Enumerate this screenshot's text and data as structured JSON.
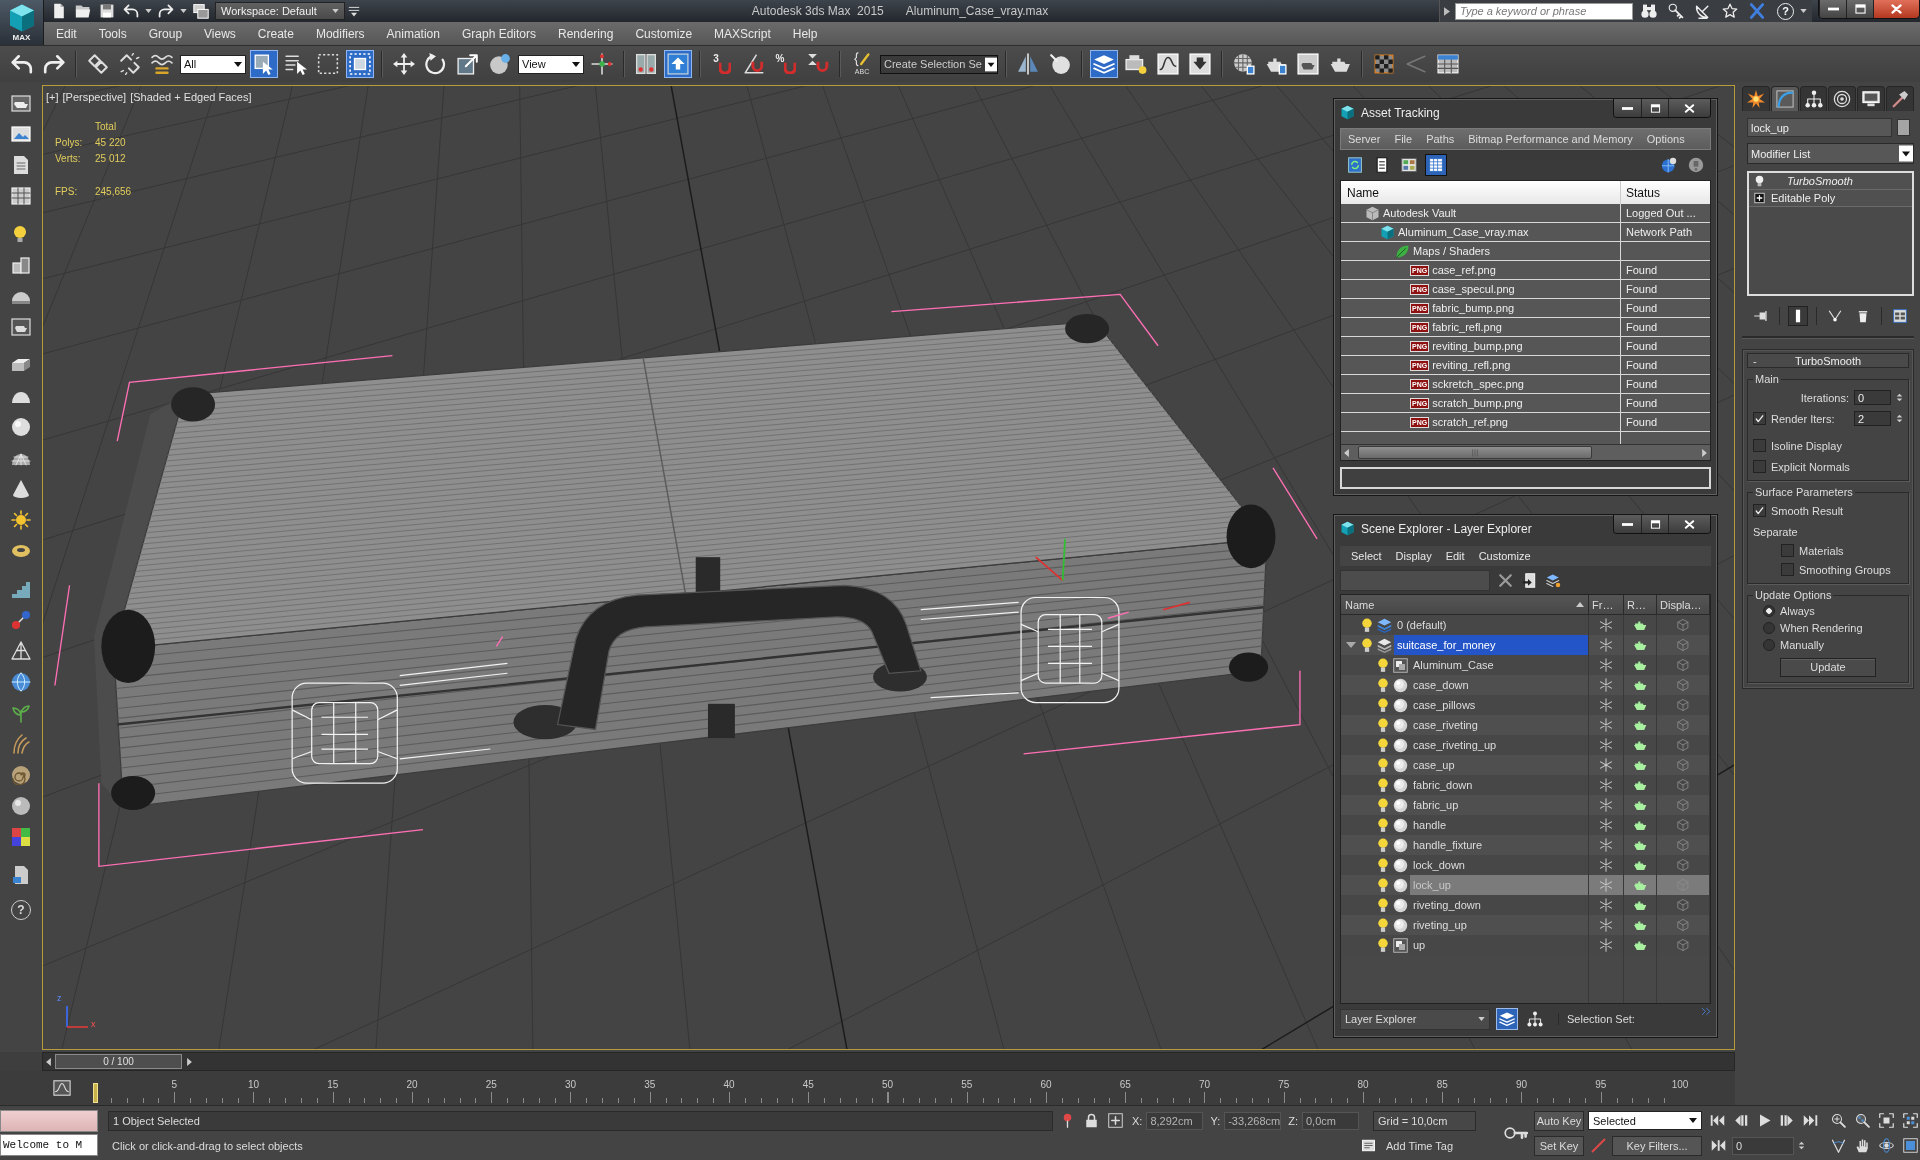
{
  "title_bar": {
    "workspace": "Workspace: Default",
    "app_name": "Autodesk 3ds Max  2015",
    "file_name": "Aluminum_Case_vray.max",
    "search": {
      "placeholder": "Type a keyword or phrase"
    },
    "help": "?"
  },
  "app_button": {
    "label": "MAX"
  },
  "menu_bar": [
    "Edit",
    "Tools",
    "Group",
    "Views",
    "Create",
    "Modifiers",
    "Animation",
    "Graph Editors",
    "Rendering",
    "Customize",
    "MAXScript",
    "Help"
  ],
  "main_toolbar": [
    [
      {
        "kind": "undo",
        "on": false
      },
      {
        "kind": "redo",
        "on": false
      }
    ],
    [
      {
        "kind": "link",
        "on": false
      },
      {
        "kind": "unlink",
        "on": false
      },
      {
        "kind": "bind",
        "on": false
      },
      {
        "kind": "dropdown",
        "value": "All"
      },
      {
        "kind": "select",
        "on": true
      },
      {
        "kind": "select-by-name",
        "on": false
      },
      {
        "kind": "region",
        "on": false
      },
      {
        "kind": "crossing",
        "on": true
      }
    ],
    [
      {
        "kind": "move",
        "on": false
      },
      {
        "kind": "rotate",
        "on": false
      },
      {
        "kind": "scale",
        "on": false
      },
      {
        "kind": "place",
        "on": false
      },
      {
        "kind": "dropdown",
        "value": "View"
      },
      {
        "kind": "pivot",
        "on": false
      }
    ],
    [
      {
        "kind": "manipulate",
        "on": false
      },
      {
        "kind": "shortcut-override",
        "on": true
      }
    ],
    [
      {
        "kind": "snap",
        "glyph": "3",
        "on": false
      },
      {
        "kind": "angle-snap",
        "on": false
      },
      {
        "kind": "percent-snap",
        "glyph": "%",
        "on": false
      },
      {
        "kind": "spinner-snap",
        "on": false
      }
    ],
    [
      {
        "kind": "edit-selection-sets",
        "glyph": "ABC",
        "on": false
      },
      {
        "kind": "combo",
        "value": "Create Selection Se"
      }
    ],
    [
      {
        "kind": "mirror",
        "on": false
      },
      {
        "kind": "align",
        "on": false
      }
    ],
    [
      {
        "kind": "scene-explorer",
        "on": true
      },
      {
        "kind": "layer-manager",
        "on": false
      },
      {
        "kind": "curve-editor",
        "on": false
      },
      {
        "kind": "schematic-view",
        "on": false
      }
    ],
    [
      {
        "kind": "material-editor",
        "on": false
      },
      {
        "kind": "render-setup",
        "on": false
      },
      {
        "kind": "frame-window",
        "on": false
      },
      {
        "kind": "render",
        "on": false
      }
    ],
    [
      {
        "kind": "checker",
        "on": false
      },
      {
        "kind": "triangle",
        "on": false
      },
      {
        "kind": "table",
        "on": false
      }
    ]
  ],
  "left_toolbar": {
    "help": "?"
  },
  "viewport": {
    "labels": [
      "[+]",
      "[Perspective]",
      "[Shaded + Edged Faces]"
    ],
    "stats": {
      "heading": "Total",
      "rows": [
        {
          "label": "Polys:",
          "value": "45 220"
        },
        {
          "label": "Verts:",
          "value": "25 012"
        }
      ],
      "fps_label": "FPS:",
      "fps": "245,656"
    },
    "axis_labels": {
      "vertical": "z",
      "horizontal": "x"
    }
  },
  "asset_tracking": {
    "title": "Asset Tracking",
    "menu": [
      "Server",
      "File",
      "Paths",
      "Bitmap Performance and Memory",
      "Options"
    ],
    "view_buttons": [
      {
        "kind": "refresh",
        "selected": false
      },
      {
        "kind": "list",
        "selected": false
      },
      {
        "kind": "thumbnails",
        "selected": false
      },
      {
        "kind": "table",
        "selected": true
      }
    ],
    "columns": [
      "Name",
      "Status"
    ],
    "assets": [
      {
        "kind": "vault",
        "name": "Autodesk Vault",
        "status": "Logged Out ...",
        "children": [
          {
            "kind": "scene-file",
            "name": "Aluminum_Case_vray.max",
            "status": "Network Path",
            "children": [
              {
                "kind": "folder",
                "name": "Maps / Shaders",
                "children": [
                  {
                    "kind": "image-file",
                    "badge": "PNG",
                    "name": "case_ref.png",
                    "status": "Found"
                  },
                  {
                    "kind": "image-file",
                    "badge": "PNG",
                    "name": "case_specul.png",
                    "status": "Found"
                  },
                  {
                    "kind": "image-file",
                    "badge": "PNG",
                    "name": "fabric_bump.png",
                    "status": "Found"
                  },
                  {
                    "kind": "image-file",
                    "badge": "PNG",
                    "name": "fabric_refl.png",
                    "status": "Found"
                  },
                  {
                    "kind": "image-file",
                    "badge": "PNG",
                    "name": "reviting_bump.png",
                    "status": "Found"
                  },
                  {
                    "kind": "image-file",
                    "badge": "PNG",
                    "name": "reviting_refl.png",
                    "status": "Found"
                  },
                  {
                    "kind": "image-file",
                    "badge": "PNG",
                    "name": "sckretch_spec.png",
                    "status": "Found"
                  },
                  {
                    "kind": "image-file",
                    "badge": "PNG",
                    "name": "scratch_bump.png",
                    "status": "Found"
                  },
                  {
                    "kind": "image-file",
                    "badge": "PNG",
                    "name": "scratch_ref.png",
                    "status": "Found"
                  }
                ]
              }
            ]
          }
        ]
      }
    ]
  },
  "scene_explorer": {
    "title": "Scene Explorer - Layer Explorer",
    "menu": [
      "Select",
      "Display",
      "Edit",
      "Customize"
    ],
    "columns": [
      "Name",
      "Fr…",
      "R…",
      "Displa…"
    ],
    "layers": [
      {
        "kind": "layer",
        "name": "0 (default)",
        "current": true,
        "selected": false,
        "highlighted": false
      },
      {
        "kind": "layer",
        "name": "suitcase_for_money",
        "current": false,
        "selected": true,
        "highlighted": false,
        "expanded": true,
        "children": [
          {
            "kind": "group",
            "name": "Aluminum_Case",
            "selected": false,
            "highlighted": false
          },
          {
            "kind": "object",
            "name": "case_down",
            "selected": false,
            "highlighted": false
          },
          {
            "kind": "object",
            "name": "case_pillows",
            "selected": false,
            "highlighted": false
          },
          {
            "kind": "object",
            "name": "case_riveting",
            "selected": false,
            "highlighted": false
          },
          {
            "kind": "object",
            "name": "case_riveting_up",
            "selected": false,
            "highlighted": false
          },
          {
            "kind": "object",
            "name": "case_up",
            "selected": false,
            "highlighted": false
          },
          {
            "kind": "object",
            "name": "fabric_down",
            "selected": false,
            "highlighted": false
          },
          {
            "kind": "object",
            "name": "fabric_up",
            "selected": false,
            "highlighted": false
          },
          {
            "kind": "object",
            "name": "handle",
            "selected": false,
            "highlighted": false
          },
          {
            "kind": "object",
            "name": "handle_fixture",
            "selected": false,
            "highlighted": false
          },
          {
            "kind": "object",
            "name": "lock_down",
            "selected": false,
            "highlighted": false
          },
          {
            "kind": "object",
            "name": "lock_up",
            "selected": false,
            "highlighted": true
          },
          {
            "kind": "object",
            "name": "riveting_down",
            "selected": false,
            "highlighted": false
          },
          {
            "kind": "object",
            "name": "riveting_up",
            "selected": false,
            "highlighted": false
          },
          {
            "kind": "group",
            "name": "up",
            "selected": false,
            "highlighted": false
          }
        ]
      }
    ],
    "footer": {
      "mode": "Layer Explorer",
      "view_buttons": [
        {
          "kind": "layers",
          "selected": true
        },
        {
          "kind": "hierarchy",
          "selected": false
        }
      ],
      "selection_set_label": "Selection Set:"
    }
  },
  "command_panel": {
    "tabs": [
      {
        "kind": "create",
        "selected": false
      },
      {
        "kind": "modify",
        "selected": true
      },
      {
        "kind": "hierarchy",
        "selected": false
      },
      {
        "kind": "motion",
        "selected": false
      },
      {
        "kind": "display",
        "selected": false
      },
      {
        "kind": "utilities",
        "selected": false
      }
    ],
    "object_name": "lock_up",
    "modifier_list": "Modifier List",
    "modifier_stack": [
      {
        "kind": "modifier",
        "name": "TurboSmooth",
        "instanced": true
      },
      {
        "kind": "base-object",
        "name": "Editable Poly",
        "instanced": false,
        "expanded": false
      }
    ],
    "stack_tools": [
      {
        "kind": "pin",
        "on": false
      },
      {
        "kind": "show-end-result",
        "on": true
      },
      {
        "kind": "make-unique",
        "on": false
      },
      {
        "kind": "remove-modifier",
        "on": false
      },
      {
        "kind": "configure-sets",
        "on": false
      }
    ],
    "rollout": {
      "sign": "-",
      "title": "TurboSmooth",
      "groups": [
        {
          "title": "Main",
          "controls": [
            {
              "kind": "spinner",
              "label": "Iterations:",
              "value": "0"
            },
            {
              "kind": "check-spinner",
              "label": "Render Iters:",
              "checked": true,
              "value": "2"
            },
            {
              "kind": "checkbox",
              "label": "Isoline Display",
              "checked": false
            },
            {
              "kind": "checkbox",
              "label": "Explicit Normals",
              "checked": false
            }
          ]
        },
        {
          "title": "Surface Parameters",
          "controls": [
            {
              "kind": "checkbox",
              "label": "Smooth Result",
              "checked": true
            },
            {
              "kind": "label",
              "label": "Separate",
              "children": [
                {
                  "kind": "checkbox",
                  "label": "Materials",
                  "checked": false
                },
                {
                  "kind": "checkbox",
                  "label": "Smoothing Groups",
                  "checked": false
                }
              ]
            }
          ]
        },
        {
          "title": "Update Options",
          "controls": [
            {
              "kind": "radio",
              "label": "Always",
              "selected": true
            },
            {
              "kind": "radio",
              "label": "When Rendering",
              "selected": false
            },
            {
              "kind": "radio",
              "label": "Manually",
              "selected": false
            },
            {
              "kind": "button",
              "label": "Update"
            }
          ]
        }
      ]
    }
  },
  "time_slider": {
    "label": "0 / 100",
    "level": 0
  },
  "track_bar": {
    "ticks": [
      "5",
      "10",
      "15",
      "20",
      "25",
      "30",
      "35",
      "40",
      "45",
      "50",
      "55",
      "60",
      "65",
      "70",
      "75",
      "80",
      "85",
      "90",
      "95",
      "100"
    ]
  },
  "status_bar": {
    "listener_output": "Welcome to M",
    "selection_info": "1 Object Selected",
    "prompt": "Click or click-and-drag to select objects",
    "coordinates": [
      {
        "axis": "X:",
        "value": "8,292cm"
      },
      {
        "axis": "Y:",
        "value": "-33,268cm"
      },
      {
        "axis": "Z:",
        "value": "0,0cm"
      }
    ],
    "grid": "Grid = 10,0cm",
    "time_tag": "Add Time Tag",
    "auto_key": "Auto Key",
    "set_key": "Set Key",
    "key_mode": "Selected",
    "key_filters": "Key Filters...",
    "current_frame": "0"
  }
}
